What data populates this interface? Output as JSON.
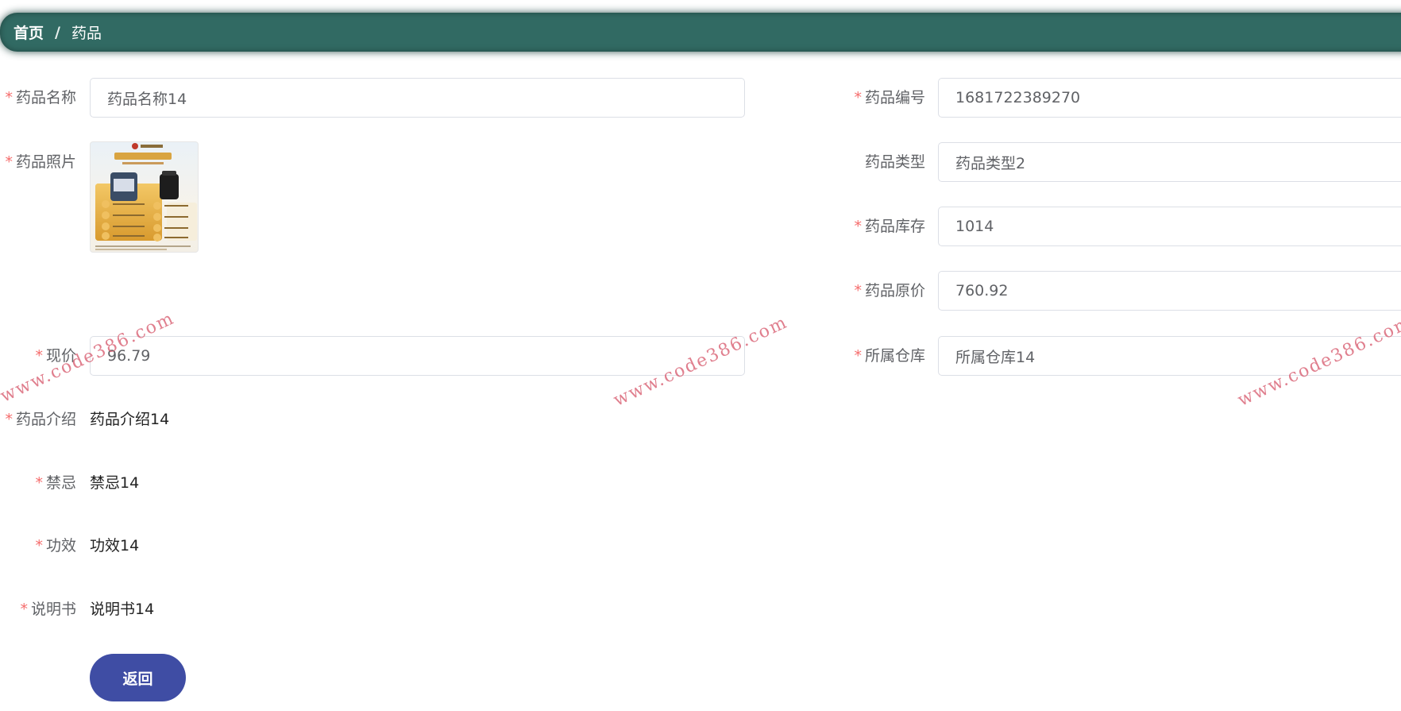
{
  "breadcrumb": {
    "home": "首页",
    "separator": "/",
    "current": "药品"
  },
  "form": {
    "name": {
      "label": "药品名称",
      "required": "*",
      "value": "药品名称14"
    },
    "code": {
      "label": "药品编号",
      "required": "*",
      "value": "1681722389270"
    },
    "photo": {
      "label": "药品照片",
      "required": "*"
    },
    "type": {
      "label": "药品类型",
      "value": "药品类型2"
    },
    "stock": {
      "label": "药品库存",
      "required": "*",
      "value": "1014"
    },
    "original_price": {
      "label": "药品原价",
      "required": "*",
      "value": "760.92"
    },
    "current_price": {
      "label": "现价",
      "required": "*",
      "value": "96.79"
    },
    "warehouse": {
      "label": "所属仓库",
      "required": "*",
      "value": "所属仓库14"
    },
    "intro": {
      "label": "药品介绍",
      "required": "*",
      "value": "药品介绍14"
    },
    "taboo": {
      "label": "禁忌",
      "required": "*",
      "value": "禁忌14"
    },
    "effect": {
      "label": "功效",
      "required": "*",
      "value": "功效14"
    },
    "manual": {
      "label": "说明书",
      "required": "*",
      "value": "说明书14"
    }
  },
  "actions": {
    "back_label": "返回"
  },
  "watermark": "www.code386.com",
  "colors": {
    "header": "#316a63",
    "button": "#3f4da4",
    "required": "#f56c6c",
    "watermark": "#d65468"
  }
}
